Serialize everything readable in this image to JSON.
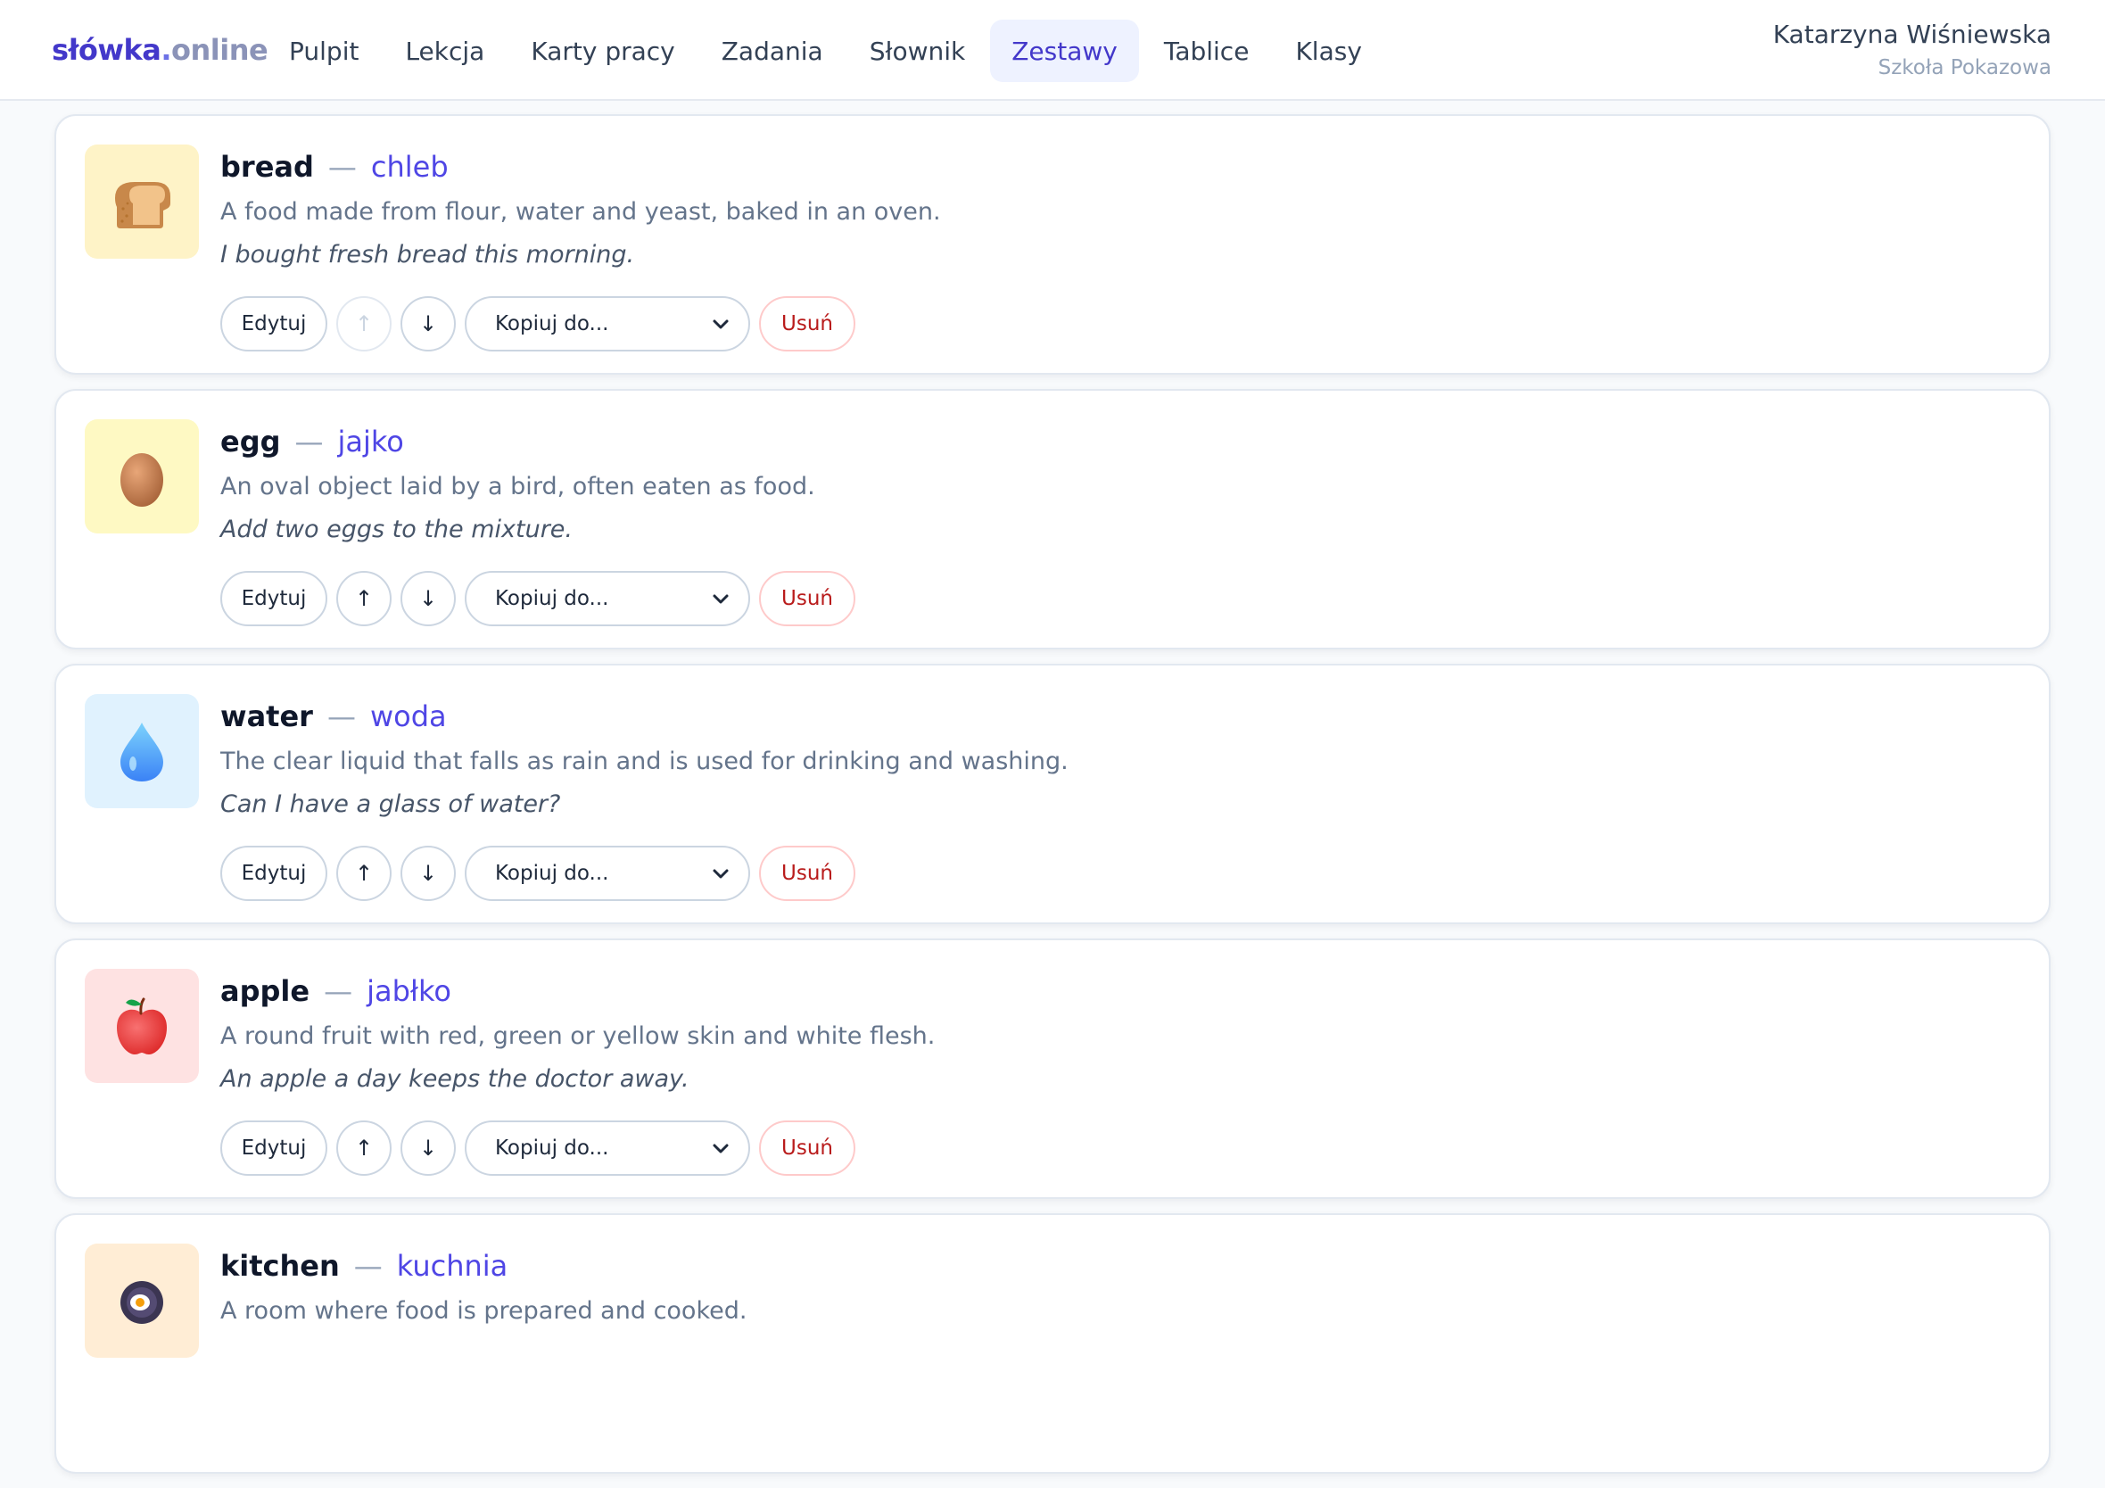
{
  "header": {
    "logo": {
      "part1": "słówka",
      "part2": ".",
      "part3": "online"
    },
    "nav": [
      {
        "label": "Pulpit"
      },
      {
        "label": "Lekcja"
      },
      {
        "label": "Karty pracy"
      },
      {
        "label": "Zadania"
      },
      {
        "label": "Słownik"
      },
      {
        "label": "Zestawy",
        "active": true
      },
      {
        "label": "Tablice"
      },
      {
        "label": "Klasy"
      }
    ],
    "user": {
      "name": "Katarzyna Wiśniewska",
      "school": "Szkoła Pokazowa"
    }
  },
  "labels": {
    "edit": "Edytuj",
    "up": "↑",
    "down": "↓",
    "copy_to": "Kopiuj do...",
    "delete": "Usuń",
    "dash": "—"
  },
  "words": [
    {
      "word": "bread",
      "translation": "chleb",
      "definition": "A food made from flour, water and yeast, baked in an oven.",
      "example": "I bought fresh bread this morning.",
      "icon": "bread-icon",
      "bg": "#fef3c7"
    },
    {
      "word": "egg",
      "translation": "jajko",
      "definition": "An oval object laid by a bird, often eaten as food.",
      "example": "Add two eggs to the mixture.",
      "icon": "egg-icon",
      "bg": "#fef9c3"
    },
    {
      "word": "water",
      "translation": "woda",
      "definition": "The clear liquid that falls as rain and is used for drinking and washing.",
      "example": "Can I have a glass of water?",
      "icon": "water-drop-icon",
      "bg": "#e0f2fe"
    },
    {
      "word": "apple",
      "translation": "jabłko",
      "definition": "A round fruit with red, green or yellow skin and white flesh.",
      "example": "An apple a day keeps the doctor away.",
      "icon": "apple-icon",
      "bg": "#fee2e2"
    },
    {
      "word": "kitchen",
      "translation": "kuchnia",
      "definition": "A room where food is prepared and cooked.",
      "example": "",
      "icon": "frying-pan-icon",
      "bg": "#ffedd5"
    }
  ]
}
